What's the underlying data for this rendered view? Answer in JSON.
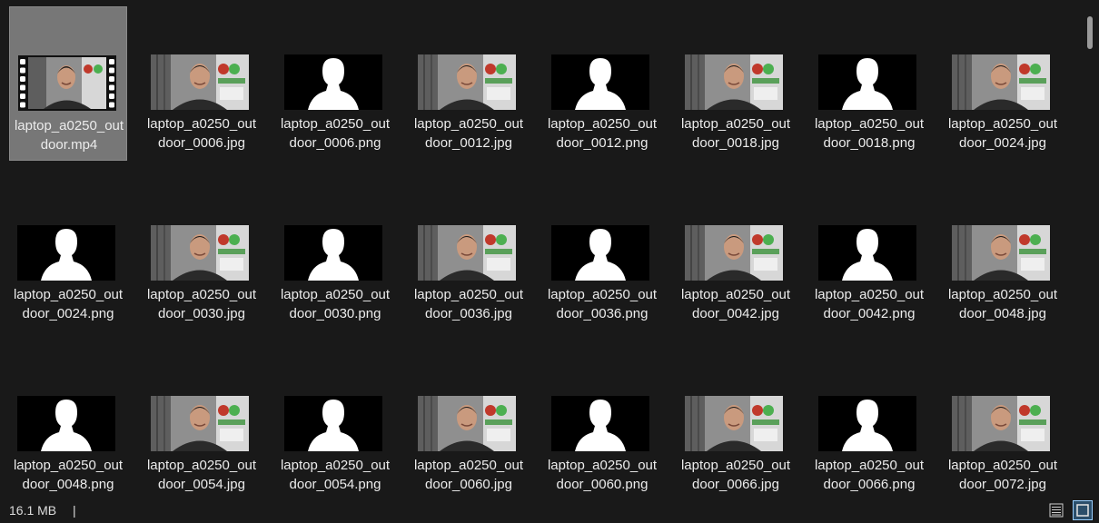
{
  "files": [
    {
      "name": "laptop_a0250_outdoor.mp4",
      "kind": "video",
      "selected": true
    },
    {
      "name": "laptop_a0250_outdoor_0006.jpg",
      "kind": "photo"
    },
    {
      "name": "laptop_a0250_outdoor_0006.png",
      "kind": "mask"
    },
    {
      "name": "laptop_a0250_outdoor_0012.jpg",
      "kind": "photo"
    },
    {
      "name": "laptop_a0250_outdoor_0012.png",
      "kind": "mask"
    },
    {
      "name": "laptop_a0250_outdoor_0018.jpg",
      "kind": "photo"
    },
    {
      "name": "laptop_a0250_outdoor_0018.png",
      "kind": "mask"
    },
    {
      "name": "laptop_a0250_outdoor_0024.jpg",
      "kind": "photo"
    },
    {
      "name": "laptop_a0250_outdoor_0024.png",
      "kind": "mask"
    },
    {
      "name": "laptop_a0250_outdoor_0030.jpg",
      "kind": "photo"
    },
    {
      "name": "laptop_a0250_outdoor_0030.png",
      "kind": "mask"
    },
    {
      "name": "laptop_a0250_outdoor_0036.jpg",
      "kind": "photo"
    },
    {
      "name": "laptop_a0250_outdoor_0036.png",
      "kind": "mask"
    },
    {
      "name": "laptop_a0250_outdoor_0042.jpg",
      "kind": "photo"
    },
    {
      "name": "laptop_a0250_outdoor_0042.png",
      "kind": "mask"
    },
    {
      "name": "laptop_a0250_outdoor_0048.jpg",
      "kind": "photo"
    },
    {
      "name": "laptop_a0250_outdoor_0048.png",
      "kind": "mask"
    },
    {
      "name": "laptop_a0250_outdoor_0054.jpg",
      "kind": "photo"
    },
    {
      "name": "laptop_a0250_outdoor_0054.png",
      "kind": "mask"
    },
    {
      "name": "laptop_a0250_outdoor_0060.jpg",
      "kind": "photo"
    },
    {
      "name": "laptop_a0250_outdoor_0060.png",
      "kind": "mask"
    },
    {
      "name": "laptop_a0250_outdoor_0066.jpg",
      "kind": "photo"
    },
    {
      "name": "laptop_a0250_outdoor_0066.png",
      "kind": "mask"
    },
    {
      "name": "laptop_a0250_outdoor_0072.jpg",
      "kind": "photo"
    }
  ],
  "statusbar": {
    "total_size": "16.1 MB",
    "separator": "|",
    "details_view_icon": "details-view-icon",
    "thumbnails_view_icon": "large-icons-view-icon"
  },
  "colors": {
    "background": "#191919",
    "selected_item": "#777777",
    "text": "#ececec",
    "active_view_border": "#9ad0ff"
  }
}
